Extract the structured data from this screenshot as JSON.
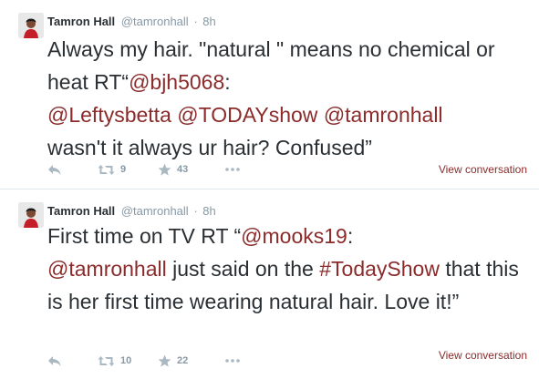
{
  "colors": {
    "link": "#8b2b2b",
    "meta": "#8899a6",
    "action_icon": "#aab8c2",
    "text": "#292f33"
  },
  "tweets": [
    {
      "author": {
        "fullname": "Tamron Hall",
        "username": "@tamronhall",
        "separator": "·",
        "time": "8h"
      },
      "segments": [
        {
          "text": "Always my hair. \"natural \" means no chemical or heat RT“",
          "link": false
        },
        {
          "text": "@bjh5068",
          "link": true
        },
        {
          "text": ": ",
          "link": false
        },
        {
          "text": "@Leftysbetta",
          "link": true
        },
        {
          "text": " ",
          "link": false
        },
        {
          "text": "@TODAYshow",
          "link": true
        },
        {
          "text": " ",
          "link": false
        },
        {
          "text": "@tamronhall",
          "link": true
        },
        {
          "text": " wasn't it always ur hair? Confused”",
          "link": false
        }
      ],
      "actions": {
        "reply_icon": "reply-icon",
        "retweet_count": "9",
        "favorite_count": "43",
        "more_icon": "more-icon"
      },
      "view_conversation": "View conversation"
    },
    {
      "author": {
        "fullname": "Tamron Hall",
        "username": "@tamronhall",
        "separator": "·",
        "time": "8h"
      },
      "segments": [
        {
          "text": "First time on TV RT “",
          "link": false
        },
        {
          "text": "@mooks19",
          "link": true
        },
        {
          "text": ": ",
          "link": false
        },
        {
          "text": "@tamronhall",
          "link": true
        },
        {
          "text": " just said on the ",
          "link": false
        },
        {
          "text": "#TodayShow",
          "link": true
        },
        {
          "text": " that this is her first time wearing natural hair. Love it!”",
          "link": false
        }
      ],
      "actions": {
        "reply_icon": "reply-icon",
        "retweet_count": "10",
        "favorite_count": "22",
        "more_icon": "more-icon"
      },
      "view_conversation": "View conversation"
    }
  ]
}
